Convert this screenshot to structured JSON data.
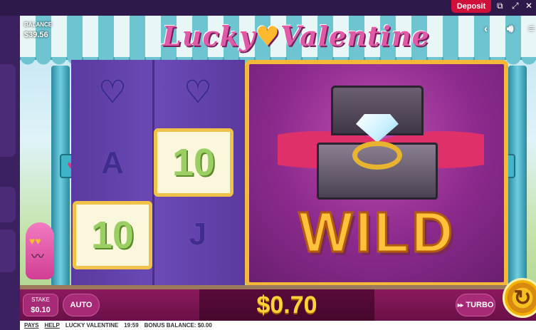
{
  "casino": {
    "deposit_label": "Deposit"
  },
  "game": {
    "title_left": "Lucky",
    "title_right": "Valentine",
    "balance_label": "BALANCE",
    "balance_value": "$39.56",
    "reels": {
      "reel1": [
        "♡",
        "A",
        "10"
      ],
      "reel2": [
        "♡",
        "10",
        "J"
      ],
      "wild_label": "WILD"
    }
  },
  "controls": {
    "stake_label": "STAKE",
    "stake_value": "$0.10",
    "auto_label": "AUTO",
    "win_value": "$0.70",
    "turbo_label": "TURBO"
  },
  "footer": {
    "pays": "PAYS",
    "help": "HELP",
    "game_name": "LUCKY VALENTINE",
    "time": "19:59",
    "bonus_balance": "BONUS BALANCE: $0.00"
  },
  "colors": {
    "accent": "#d0103a",
    "win_text": "#ffd23a",
    "bar": "#8a1a5c"
  }
}
